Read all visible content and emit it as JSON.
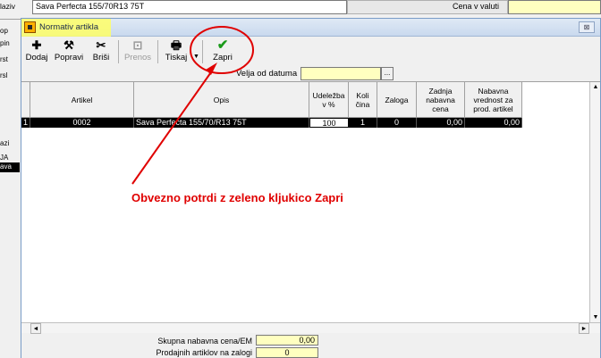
{
  "background_window": {
    "naziv_label": "laziv",
    "naziv_value": "Sava Perfecta 155/70R13 75T",
    "cena_label": "Cena v valuti",
    "left_labels": [
      "op",
      "pin",
      "rst",
      "rsl",
      "azi",
      "JA"
    ],
    "left_selected": "ava"
  },
  "dialog": {
    "title": "Normativ artikla",
    "close_label": "⊠",
    "toolbar": {
      "dodaj": "Dodaj",
      "popravi": "Popravi",
      "brisi": "Briši",
      "prenos": "Prenos",
      "tiskaj": "Tiskaj",
      "zapri": "Zapri"
    },
    "velja_od_datuma_label": "Velja od datuma",
    "velja_od_datuma_value": "",
    "velja_btn": "...",
    "columns": [
      "",
      "Artikel",
      "Opis",
      "Udeležba\nv %",
      "Koli\nčina",
      "Zaloga",
      "Zadnja\nnabavna\ncena",
      "Nabavna\nvrednost za\nprod. artikel"
    ],
    "rows": [
      {
        "num": "1",
        "artikel": "0002",
        "opis": "Sava Perfecta 155/70/R13 75T",
        "udelezba": "100",
        "kolicina": "1",
        "zaloga": "0",
        "zadnja": "0,00",
        "nabavna": "0,00"
      }
    ],
    "footer": {
      "skupna_label": "Skupna nabavna cena/EM",
      "skupna_value": "0,00",
      "prodajnih_label": "Prodajnih artiklov na zalogi",
      "prodajnih_value": "0"
    }
  },
  "annotation": {
    "text": "Obvezno potrdi z zeleno kljukico Zapri",
    "color": "#e00000"
  },
  "colors": {
    "highlight_yellow": "#ffff66",
    "field_yellow": "#ffffc0",
    "checkmark_green": "#1a9a1a"
  }
}
